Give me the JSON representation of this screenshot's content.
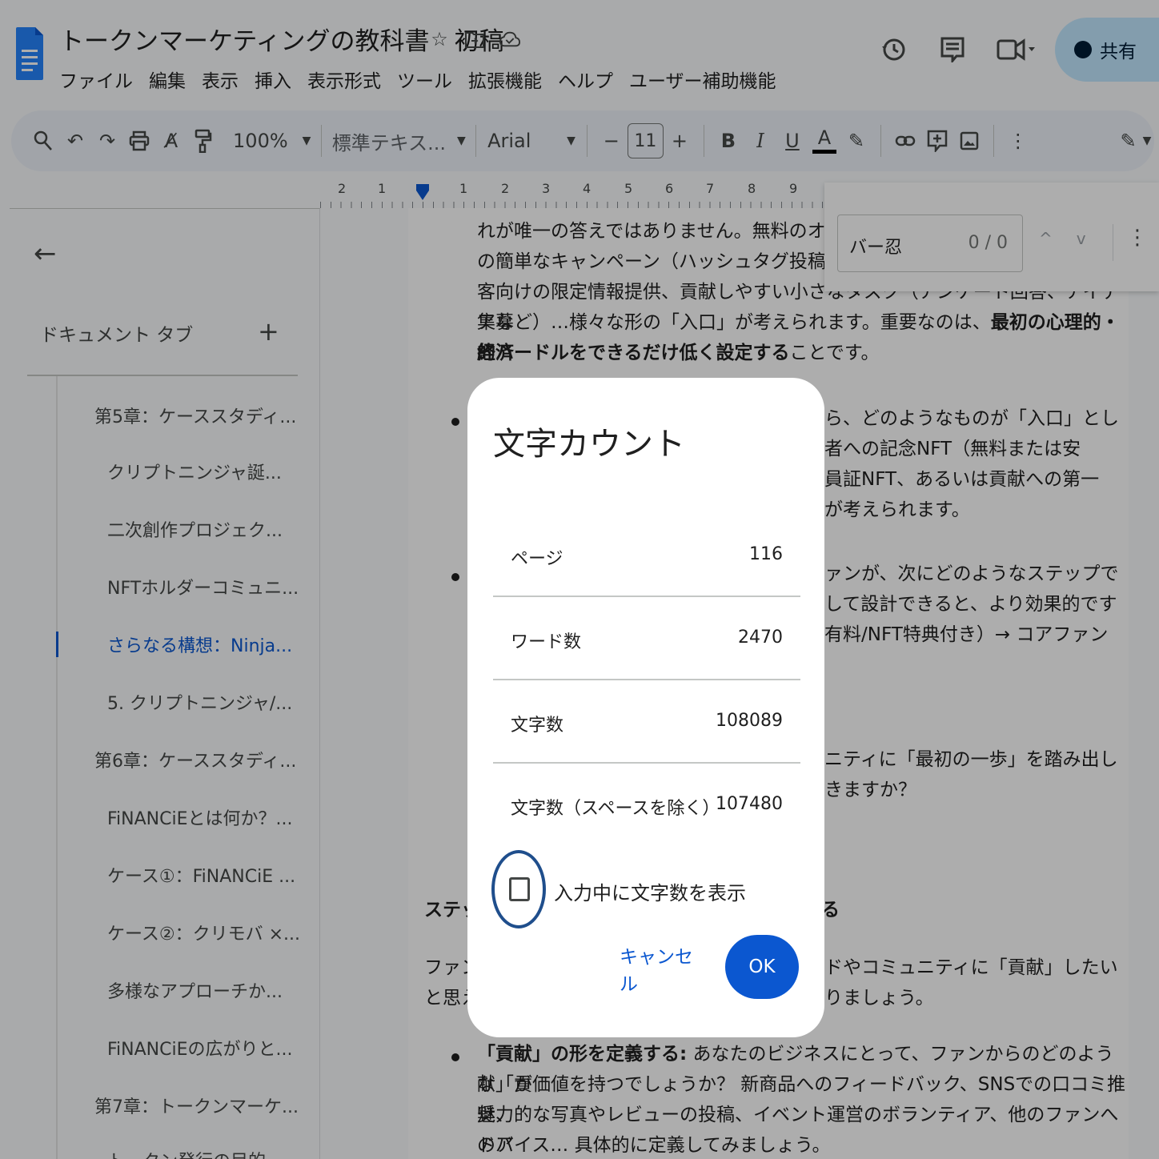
{
  "doc": {
    "title": "トークンマーケティングの教科書　初稿"
  },
  "menu": [
    "ファイル",
    "編集",
    "表示",
    "挿入",
    "表示形式",
    "ツール",
    "拡張機能",
    "ヘルプ",
    "ユーザー補助機能"
  ],
  "share": {
    "label": "共有"
  },
  "toolbar": {
    "zoom": "100%",
    "style": "標準テキス...",
    "font": "Arial",
    "font_size": "11",
    "bold": "B",
    "italic": "I",
    "underline": "U",
    "text_color_glyph": "A"
  },
  "ruler": {
    "labels": [
      "2",
      "1",
      "1",
      "2",
      "3",
      "4",
      "5",
      "6",
      "7",
      "8",
      "9"
    ]
  },
  "sidebar": {
    "heading": "ドキュメント タブ",
    "items": [
      {
        "label": "第5章：ケーススタディ..."
      },
      {
        "label": "クリプトニンジャ誕..."
      },
      {
        "label": "二次創作プロジェク..."
      },
      {
        "label": "NFTホルダーコミュニ..."
      },
      {
        "label": "さらなる構想：Ninja..."
      },
      {
        "label": "5. クリプトニンジャ/..."
      },
      {
        "label": "第6章：ケーススタディ..."
      },
      {
        "label": "FiNANCiEとは何か？..."
      },
      {
        "label": "ケース①：FiNANCiE ..."
      },
      {
        "label": "ケース②：クリモバ ×..."
      },
      {
        "label": "多様なアプローチか..."
      },
      {
        "label": "FiNANCiEの広がりと..."
      },
      {
        "label": "第7章：トークンマーケ..."
      },
      {
        "label": "トークン発行の目的"
      }
    ]
  },
  "find": {
    "query": "バー忍",
    "count": "0 / 0"
  },
  "body": {
    "p1_l1": "れが唯一の答えではありません。無料のオンライ",
    "p1_l2": "の簡単なキャンペーン（ハッシュタグ投稿など）",
    "p1_l3": "客向けの限定情報提供、貢献しやすい小さなタスク（アンケート回答、アイデア募",
    "p1_l4a": "集など）…様々な形の「入口」が考えられます。重要なのは、",
    "p1_l4b": "最初の心理的・経済",
    "p1_l5a": "的ハードルをできるだけ低く設定する",
    "p1_l5b": "ことです。",
    "b1_l1": "ら、どのようなものが「入口」とし",
    "b1_l2": "者への記念NFT（無料または安",
    "b1_l3": "員証NFT、あるいは貢献への第一",
    "b1_l4": "が考えられます。",
    "b2_l1": "ァンが、次にどのようなステップで",
    "b2_l2": "して設計できると、より効果的です",
    "b2_l3": "有料/NFT特典付き）→ コアファン",
    "b3_l1": "ニティに「最初の一歩」を踏み出し",
    "b3_l2": "きますか？",
    "h_left": "ステッ",
    "h_right": "る",
    "p2_l1a": "ファン",
    "p2_l1b": "ドやコミュニティに「貢献」したい",
    "p2_l2a": "と思え",
    "p2_l2b": "りましょう。",
    "b4_l1a": "「貢献」の形を定義する:",
    "b4_l1b": " あなたのビジネスにとって、ファンからのどのような「貢",
    "b4_l2": "献」が価値を持つでしょうか？ 新商品へのフィードバック、SNSでの口コミ推奨、",
    "b4_l3": "魅力的な写真やレビューの投稿、イベント運営のボランティア、他のファンへのア",
    "b4_l4": "ドバイス… 具体的に定義してみましょう。"
  },
  "dialog": {
    "title": "文字カウント",
    "rows": [
      {
        "label": "ページ",
        "value": "116"
      },
      {
        "label": "ワード数",
        "value": "2470"
      },
      {
        "label": "文字数",
        "value": "108089"
      },
      {
        "label": "文字数（スペースを除く）",
        "value": "107480"
      }
    ],
    "checkbox_label": "入力中に文字数を表示",
    "checkbox_checked": false,
    "cancel": "キャンセル",
    "ok": "OK"
  },
  "colors": {
    "accent": "#0b57d0",
    "share_bg": "#c2e7ff",
    "toolbar_bg": "#edf2fa"
  }
}
